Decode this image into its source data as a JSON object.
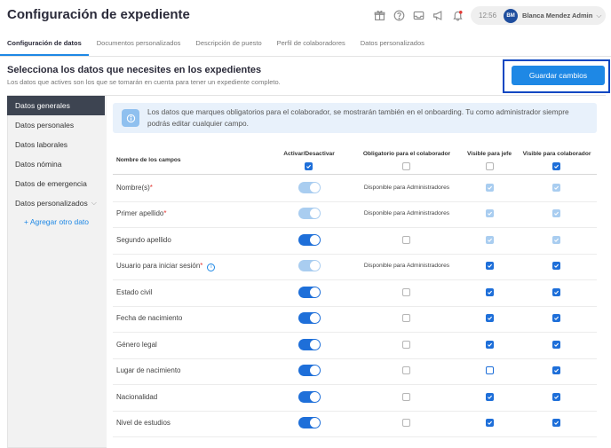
{
  "header": {
    "title": "Configuración de expediente",
    "time": "12:56",
    "avatar_initials": "BM",
    "user_name": "Blanca Mendez Admin",
    "icons": [
      "gift-icon",
      "help-icon",
      "inbox-icon",
      "megaphone-icon",
      "bell-icon"
    ]
  },
  "tabs": [
    {
      "label": "Configuración de datos"
    },
    {
      "label": "Documentos personalizados"
    },
    {
      "label": "Descripción de puesto"
    },
    {
      "label": "Perfil de colaboradores"
    },
    {
      "label": "Datos personalizados"
    }
  ],
  "section": {
    "title": "Selecciona los datos que necesites en los expedientes",
    "subtitle": "Los datos que actives son los que se tomarán en cuenta para tener un expediente completo."
  },
  "save_label": "Guardar cambios",
  "sidebar": {
    "items": [
      {
        "label": "Datos generales"
      },
      {
        "label": "Datos personales"
      },
      {
        "label": "Datos laborales"
      },
      {
        "label": "Datos nómina"
      },
      {
        "label": "Datos de emergencia"
      },
      {
        "label": "Datos personalizados"
      }
    ],
    "add_label": "+ Agregar otro dato"
  },
  "info_text": "Los datos que marques obligatorios para el colaborador, se mostrarán también en el onboarding. Tu como administrador siempre podrás editar cualquier campo.",
  "table": {
    "headers": {
      "name": "Nombre de los campos",
      "active": "Activar/Desactivar",
      "required": "Obligatorio para el colaborador",
      "boss": "Visible para jefe",
      "collab": "Visible para colaborador"
    },
    "admin_only_text": "Disponible para Administradores",
    "rows": [
      {
        "label": "Nombre(s)",
        "required_mark": "*",
        "toggle": "disabled",
        "required": "admin",
        "boss": "checked-disabled",
        "collab": "checked-disabled"
      },
      {
        "label": "Primer apellido",
        "required_mark": "*",
        "toggle": "disabled",
        "required": "admin",
        "boss": "checked-disabled",
        "collab": "checked-disabled"
      },
      {
        "label": "Segundo apellido",
        "required_mark": "",
        "toggle": "on",
        "required": "empty",
        "boss": "checked-disabled",
        "collab": "checked-disabled"
      },
      {
        "label": "Usuario para iniciar sesión",
        "required_mark": "*",
        "help": true,
        "toggle": "disabled",
        "required": "admin",
        "boss": "checked",
        "collab": "checked"
      },
      {
        "label": "Estado civil",
        "required_mark": "",
        "toggle": "on",
        "required": "empty",
        "boss": "checked",
        "collab": "checked"
      },
      {
        "label": "Fecha de nacimiento",
        "required_mark": "",
        "toggle": "on",
        "required": "empty",
        "boss": "checked",
        "collab": "checked"
      },
      {
        "label": "Género legal",
        "required_mark": "",
        "toggle": "on",
        "required": "empty",
        "boss": "checked",
        "collab": "checked"
      },
      {
        "label": "Lugar de nacimiento",
        "required_mark": "",
        "toggle": "on",
        "required": "empty",
        "boss": "empty-blue",
        "collab": "checked"
      },
      {
        "label": "Nacionalidad",
        "required_mark": "",
        "toggle": "on",
        "required": "empty",
        "boss": "checked",
        "collab": "checked"
      },
      {
        "label": "Nivel de estudios",
        "required_mark": "",
        "toggle": "on",
        "required": "empty",
        "boss": "checked",
        "collab": "checked"
      }
    ]
  },
  "colors": {
    "accent": "#1e88e5",
    "toggle_on": "#1e6fd9",
    "toggle_disabled": "#a9cdf0",
    "sidebar_active": "#3d4451",
    "highlight_frame": "#0a47c2"
  }
}
